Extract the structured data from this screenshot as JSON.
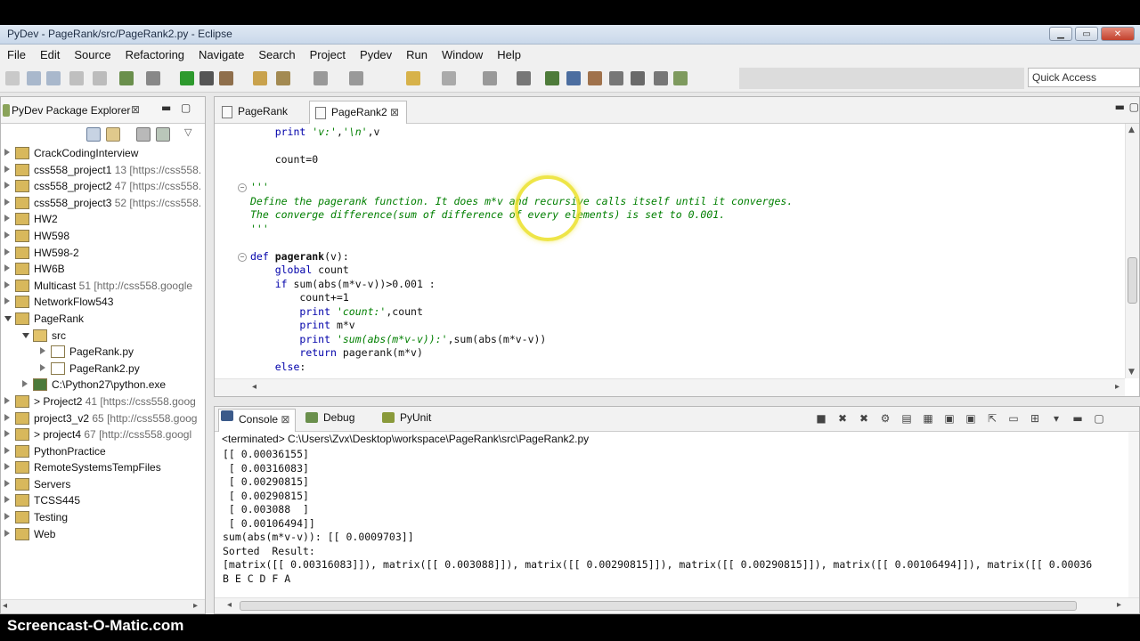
{
  "window": {
    "title": "PyDev - PageRank/src/PageRank2.py - Eclipse"
  },
  "menu": [
    "File",
    "Edit",
    "Source",
    "Refactoring",
    "Navigate",
    "Search",
    "Project",
    "Pydev",
    "Run",
    "Window",
    "Help"
  ],
  "quick_access": "Quick Access",
  "explorer": {
    "title": "PyDev Package Explorer",
    "close": "⊠",
    "items": [
      {
        "label": "CrackCodingInterview",
        "extra": "",
        "depth": 0,
        "open": false,
        "icon": "project-icon"
      },
      {
        "label": "css558_project1",
        "extra": " 13 [https://css558.",
        "depth": 0,
        "open": false,
        "icon": "project-icon"
      },
      {
        "label": "css558_project2",
        "extra": " 47 [https://css558.",
        "depth": 0,
        "open": false,
        "icon": "project-icon"
      },
      {
        "label": "css558_project3",
        "extra": " 52 [https://css558.",
        "depth": 0,
        "open": false,
        "icon": "project-icon"
      },
      {
        "label": "HW2",
        "extra": "",
        "depth": 0,
        "open": false,
        "icon": "project-icon"
      },
      {
        "label": "HW598",
        "extra": "",
        "depth": 0,
        "open": false,
        "icon": "project-icon"
      },
      {
        "label": "HW598-2",
        "extra": "",
        "depth": 0,
        "open": false,
        "icon": "project-icon"
      },
      {
        "label": "HW6B",
        "extra": "",
        "depth": 0,
        "open": false,
        "icon": "project-icon"
      },
      {
        "label": "Multicast",
        "extra": " 51 [http://css558.google",
        "depth": 0,
        "open": false,
        "icon": "project-icon"
      },
      {
        "label": "NetworkFlow543",
        "extra": "",
        "depth": 0,
        "open": false,
        "icon": "project-icon"
      },
      {
        "label": "PageRank",
        "extra": "",
        "depth": 0,
        "open": true,
        "icon": "project-icon"
      },
      {
        "label": "src",
        "extra": "",
        "depth": 1,
        "open": true,
        "icon": "folder-icon"
      },
      {
        "label": "PageRank.py",
        "extra": "",
        "depth": 2,
        "open": false,
        "icon": "python-file-icon"
      },
      {
        "label": "PageRank2.py",
        "extra": "",
        "depth": 2,
        "open": false,
        "icon": "python-file-icon"
      },
      {
        "label": "C:\\Python27\\python.exe",
        "extra": "",
        "depth": 1,
        "open": false,
        "icon": "python-interpreter-icon"
      },
      {
        "label": "> Project2",
        "extra": " 41 [https://css558.goog",
        "depth": 0,
        "open": false,
        "icon": "project-icon"
      },
      {
        "label": "project3_v2",
        "extra": " 65 [http://css558.goog",
        "depth": 0,
        "open": false,
        "icon": "project-icon"
      },
      {
        "label": "> project4",
        "extra": " 67 [http://css558.googl",
        "depth": 0,
        "open": false,
        "icon": "project-icon"
      },
      {
        "label": "PythonPractice",
        "extra": "",
        "depth": 0,
        "open": false,
        "icon": "project-icon"
      },
      {
        "label": "RemoteSystemsTempFiles",
        "extra": "",
        "depth": 0,
        "open": false,
        "icon": "project-icon"
      },
      {
        "label": "Servers",
        "extra": "",
        "depth": 0,
        "open": false,
        "icon": "project-icon"
      },
      {
        "label": "TCSS445",
        "extra": "",
        "depth": 0,
        "open": false,
        "icon": "project-icon"
      },
      {
        "label": "Testing",
        "extra": "",
        "depth": 0,
        "open": false,
        "icon": "project-icon"
      },
      {
        "label": "Web",
        "extra": "",
        "depth": 0,
        "open": false,
        "icon": "project-icon"
      }
    ]
  },
  "editor": {
    "tabs": [
      {
        "label": "PageRank",
        "active": false
      },
      {
        "label": "PageRank2",
        "active": true
      }
    ],
    "lines": [
      "    print 'v:','\\n',v",
      "",
      "    count=0",
      "",
      "'''",
      "Define the pagerank function. It does m*v and recursive calls itself until it converges.",
      "The converge difference(sum of difference of every elements) is set to 0.001.",
      "'''",
      "",
      "def pagerank(v):",
      "    global count",
      "    if sum(abs(m*v-v))>0.001 :",
      "        count+=1",
      "        print 'count:',count",
      "        print m*v",
      "        print 'sum(abs(m*v-v)):',sum(abs(m*v-v))",
      "        return pagerank(m*v)",
      "    else:"
    ]
  },
  "console": {
    "tabs": [
      {
        "label": "Console",
        "close": "⊠"
      },
      {
        "label": "Debug"
      },
      {
        "label": "PyUnit"
      }
    ],
    "terminated": "<terminated> C:\\Users\\Zvx\\Desktop\\workspace\\PageRank\\src\\PageRank2.py",
    "output": [
      "[[ 0.00036155]",
      " [ 0.00316083]",
      " [ 0.00290815]",
      " [ 0.00290815]",
      " [ 0.003088  ]",
      " [ 0.00106494]]",
      "sum(abs(m*v-v)): [[ 0.0009703]]",
      "Sorted  Result:",
      "[matrix([[ 0.00316083]]), matrix([[ 0.003088]]), matrix([[ 0.00290815]]), matrix([[ 0.00290815]]), matrix([[ 0.00106494]]), matrix([[ 0.00036",
      "B E C D F A"
    ]
  },
  "watermark": "Screencast-O-Matic.com",
  "colors": {
    "keyword": "#0000aa",
    "comment": "#007f00",
    "highlight": "#ebe128"
  }
}
